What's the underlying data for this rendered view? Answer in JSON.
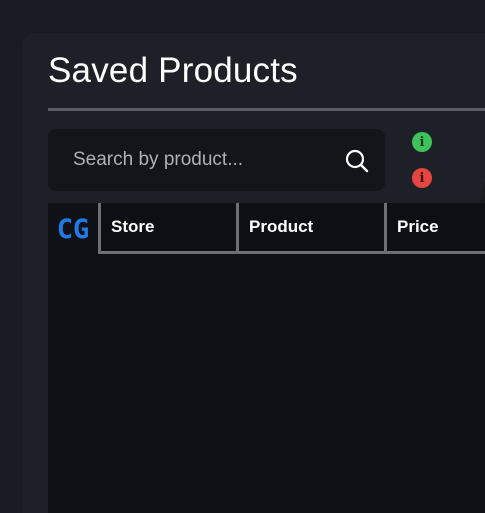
{
  "page": {
    "title": "Saved Products"
  },
  "search": {
    "placeholder": "Search by product..."
  },
  "status_icons": {
    "info_green": "info-circle-icon",
    "info_red": "info-circle-icon",
    "green_color": "#3ec25b",
    "red_color": "#e5463f"
  },
  "table": {
    "logo_text": "CG",
    "logo_color": "#1f7ae8",
    "columns": [
      "Store",
      "Product",
      "Price"
    ],
    "rows": []
  }
}
